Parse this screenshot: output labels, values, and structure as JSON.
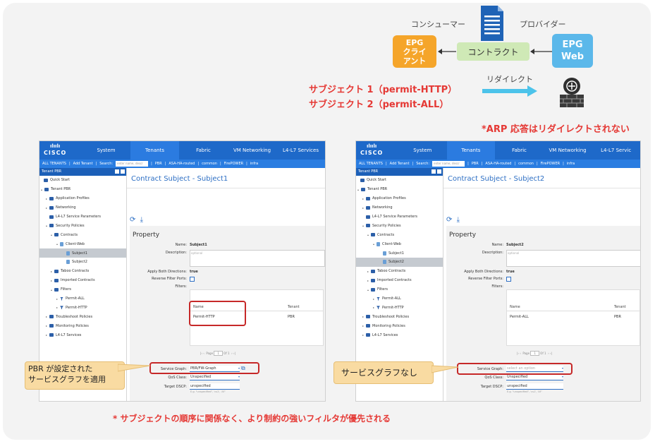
{
  "diagram": {
    "consumer_label": "コンシューマー",
    "provider_label": "プロバイダー",
    "epg_client": "EPG\nクライ\nアント",
    "epg_web": "EPG\nWeb",
    "contract": "コントラクト",
    "redirect_label": "リダイレクト",
    "subject1": "サブジェクト 1（permit-HTTP）",
    "subject2": "サブジェクト 2（permit-ALL）",
    "arp_note": "*ARP 応答はリダイレクトされない"
  },
  "panel_left": {
    "logo": "CISCO",
    "nav": [
      "System",
      "Tenants",
      "Fabric",
      "VM Networking",
      "L4-L7 Services"
    ],
    "active_nav": 1,
    "subbar": {
      "all_tenants": "ALL TENANTS",
      "add_tenant": "Add Tenant",
      "search_label": "Search:",
      "search_placeholder": "enter name, descr",
      "tenants": [
        "PBR",
        "ASA-HA-routed",
        "common",
        "FirePOWER",
        "infra"
      ]
    },
    "sidebar_title": "Tenant PBR",
    "tree": [
      "Quick Start",
      "Tenant PBR",
      "Application Profiles",
      "Networking",
      "L4-L7 Service Parameters",
      "Security Policies",
      "Contracts",
      "Client-Web",
      "Subject1",
      "Subject2",
      "Taboo Contracts",
      "Imported Contracts",
      "Filters",
      "Permit-ALL",
      "Permit-HTTP",
      "Troubleshoot Policies",
      "Monitoring Policies",
      "L4-L7 Services"
    ],
    "title": "Contract Subject - Subject1",
    "property": "Property",
    "name_label": "Name:",
    "name_value": "Subject1",
    "description_label": "Description:",
    "description_placeholder": "optional",
    "apply_both_label": "Apply Both Directions:",
    "apply_both_value": "true",
    "reverse_ports_label": "Reverse Filter Ports:",
    "filters_label": "Filters:",
    "col_name": "Name",
    "col_tenant": "Tenant",
    "filter_name": "Permit-HTTP",
    "filter_tenant": "PBR",
    "pager_page": "Page",
    "pager_num": "1",
    "pager_of": "Of 1",
    "service_graph_label": "Service Graph:",
    "service_graph_value": "PBR/FW-Graph",
    "qos_label": "QoS Class:",
    "qos_value": "Unspecified",
    "dscp_label": "Target DSCP:",
    "dscp_value": "unspecified",
    "hint": "E.g. \"unspecified\", 'cs1', 'AF'",
    "callout": "PBR が設定された\nサービスグラフを適用"
  },
  "panel_right": {
    "logo": "CISCO",
    "nav": [
      "System",
      "Tenants",
      "Fabric",
      "VM Networking",
      "L4-L7 Servic"
    ],
    "active_nav": 1,
    "subbar": {
      "all_tenants": "ALL TENANTS",
      "add_tenant": "Add Tenant",
      "search_label": "Search:",
      "search_placeholder": "enter name, descr",
      "tenants": [
        "PBR",
        "ASA-HA-routed",
        "common",
        "FirePOWER",
        "infra"
      ]
    },
    "sidebar_title": "Tenant PBR",
    "tree": [
      "Quick Start",
      "Tenant PBR",
      "Application Profiles",
      "Networking",
      "L4-L7 Service Parameters",
      "Security Policies",
      "Contracts",
      "Client-Web",
      "Subject1",
      "Subject2",
      "Taboo Contracts",
      "Imported Contracts",
      "Filters",
      "Permit-ALL",
      "Permit-HTTP",
      "Troubleshoot Policies",
      "Monitoring Policies",
      "L4-L7 Services"
    ],
    "title": "Contract Subject - Subject2",
    "property": "Property",
    "name_label": "Name:",
    "name_value": "Subject2",
    "description_label": "Description:",
    "description_placeholder": "optional",
    "apply_both_label": "Apply Both Directions:",
    "apply_both_value": "true",
    "reverse_ports_label": "Reverse Filter Ports:",
    "filters_label": "Filters:",
    "col_name": "Name",
    "col_tenant": "Tenant",
    "filter_name": "Permit-ALL",
    "filter_tenant": "PBR",
    "pager_page": "Page",
    "pager_num": "1",
    "pager_of": "Of 1",
    "service_graph_label": "Service Graph:",
    "service_graph_value": "select an option",
    "qos_label": "QoS Class:",
    "qos_value": "Unspecified",
    "dscp_label": "Target DSCP:",
    "dscp_value": "unspecified",
    "hint": "E.g. \"unspecified\", 'cs1', 'AF'",
    "callout": "サービスグラフなし"
  },
  "bottom_note": "* サブジェクトの順序に関係なく、より制約の強いフィルタが優先される",
  "colors": {
    "accent_blue": "#1e69c9",
    "red": "#e53935",
    "epg_orange": "#f5a52a",
    "epg_blue": "#5bb8ea",
    "contract_green": "#cfe9b6",
    "callout": "#f9dba2"
  }
}
